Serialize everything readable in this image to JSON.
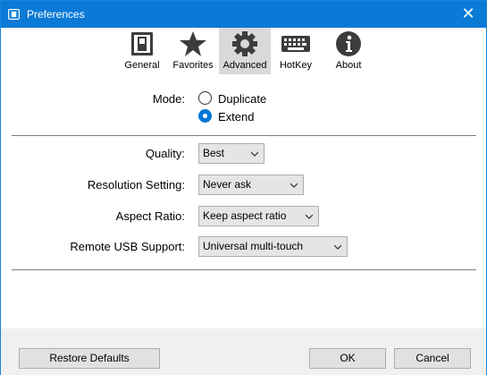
{
  "window": {
    "title": "Preferences"
  },
  "toolbar": {
    "tabs": [
      {
        "label": "General",
        "icon": "switch-icon"
      },
      {
        "label": "Favorites",
        "icon": "star-icon"
      },
      {
        "label": "Advanced",
        "icon": "gear-icon",
        "active": true
      },
      {
        "label": "HotKey",
        "icon": "keyboard-icon"
      },
      {
        "label": "About",
        "icon": "info-icon"
      }
    ]
  },
  "mode": {
    "label": "Mode:",
    "options": [
      {
        "label": "Duplicate",
        "selected": false
      },
      {
        "label": "Extend",
        "selected": true
      }
    ]
  },
  "settings": {
    "quality": {
      "label": "Quality:",
      "value": "Best"
    },
    "resolution": {
      "label": "Resolution Setting:",
      "value": "Never ask"
    },
    "aspect": {
      "label": "Aspect Ratio:",
      "value": "Keep aspect ratio"
    },
    "usb": {
      "label": "Remote USB Support:",
      "value": "Universal multi-touch"
    }
  },
  "footer": {
    "restore_label": "Restore Defaults",
    "ok_label": "OK",
    "cancel_label": "Cancel"
  },
  "colors": {
    "titlebar": "#0b7ad6",
    "accent": "#0078d7"
  }
}
